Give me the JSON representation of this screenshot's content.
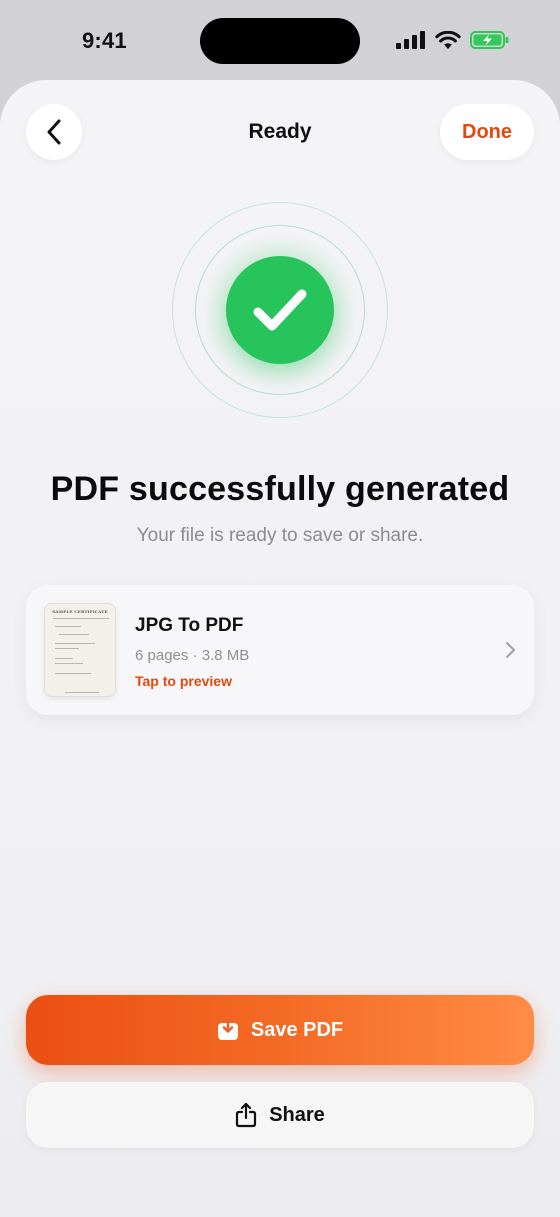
{
  "status_bar": {
    "time": "9:41"
  },
  "nav": {
    "title": "Ready",
    "done_label": "Done"
  },
  "success": {
    "headline": "PDF successfully generated",
    "subtext": "Your file is ready to save or share."
  },
  "file": {
    "name": "JPG To PDF",
    "meta": "6 pages · 3.8 MB",
    "link": "Tap to preview",
    "thumbnail_title": "SAMPLE CERTIFICATE"
  },
  "actions": {
    "save_label": "Save PDF",
    "share_label": "Share"
  },
  "colors": {
    "accent": "#e04a10",
    "success": "#27c45c",
    "save_start": "#ea4f12",
    "save_end": "#ff8c45"
  },
  "icons": [
    "back-chevron-icon",
    "checkmark-icon",
    "chevron-right-icon",
    "download-icon",
    "share-icon",
    "signal-icon",
    "wifi-icon",
    "battery-icon"
  ]
}
